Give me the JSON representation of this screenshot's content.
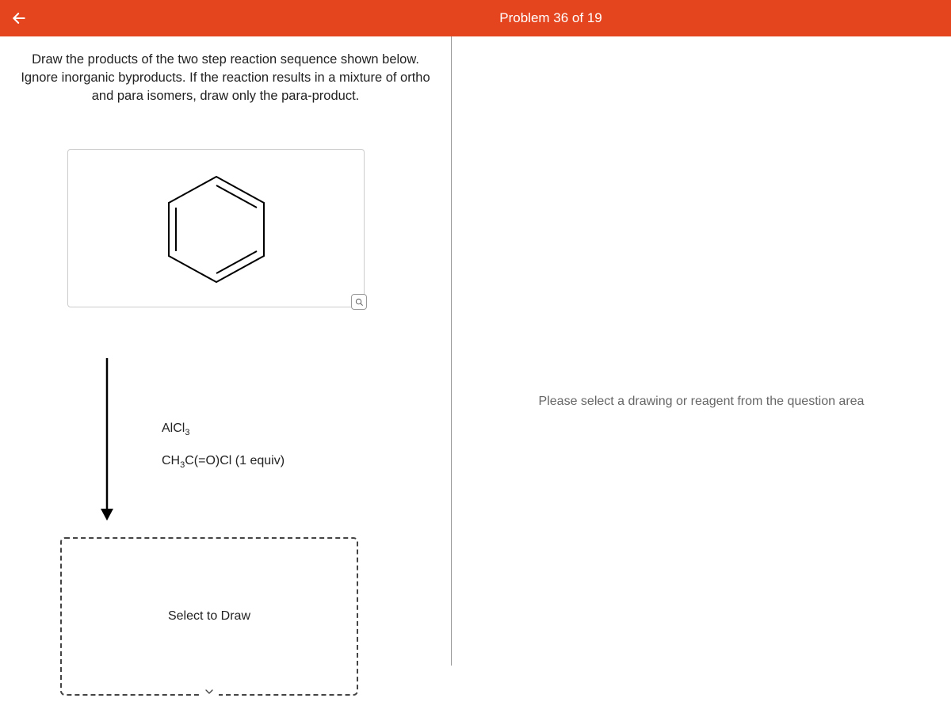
{
  "header": {
    "title": "Problem 36 of 19"
  },
  "problem": {
    "text": "Draw the products of the two step reaction sequence shown below. Ignore inorganic byproducts. If the reaction results in a mixture of ortho and para isomers, draw only the para-product."
  },
  "reagents": {
    "line1_part1": "AlCl",
    "line1_sub": "3",
    "line2_part1": "CH",
    "line2_sub": "3",
    "line2_part2": "C(=O)Cl (1 equiv)"
  },
  "drawBox": {
    "label": "Select to Draw"
  },
  "rightPanel": {
    "placeholder": "Please select a drawing or reagent from the question area"
  }
}
